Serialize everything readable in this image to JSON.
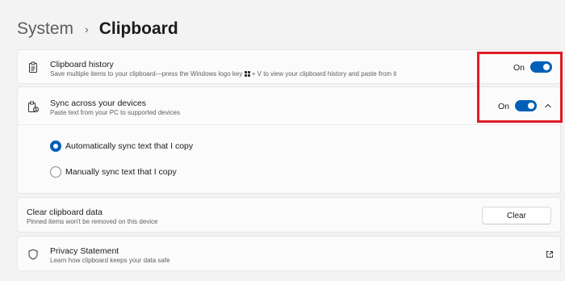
{
  "breadcrumb": {
    "parent": "System",
    "separator": "›",
    "current": "Clipboard"
  },
  "clipboard_history": {
    "icon": "clipboard-icon",
    "title": "Clipboard history",
    "subtitle_before_key": "Save multiple items to your clipboard—press the Windows logo key ",
    "subtitle_after_key": " + V to view your clipboard history and paste from it",
    "toggle_label": "On",
    "toggle_on": true
  },
  "sync": {
    "icon": "clipboard-sync-icon",
    "title": "Sync across your devices",
    "subtitle": "Paste text from your PC to supported devices",
    "toggle_label": "On",
    "toggle_on": true,
    "expanded": true,
    "options": [
      {
        "label": "Automatically sync text that I copy",
        "selected": true
      },
      {
        "label": "Manually sync text that I copy",
        "selected": false
      }
    ]
  },
  "clear_data": {
    "title": "Clear clipboard data",
    "subtitle": "Pinned items won't be removed on this device",
    "button_label": "Clear"
  },
  "privacy": {
    "icon": "shield-icon",
    "title": "Privacy Statement",
    "subtitle": "Learn how clipboard keeps your data safe",
    "link_icon": "external-link-icon"
  },
  "colors": {
    "accent": "#005fb8",
    "annotation": "#e01b24",
    "background": "#f3f3f3",
    "card": "#fbfbfb"
  }
}
